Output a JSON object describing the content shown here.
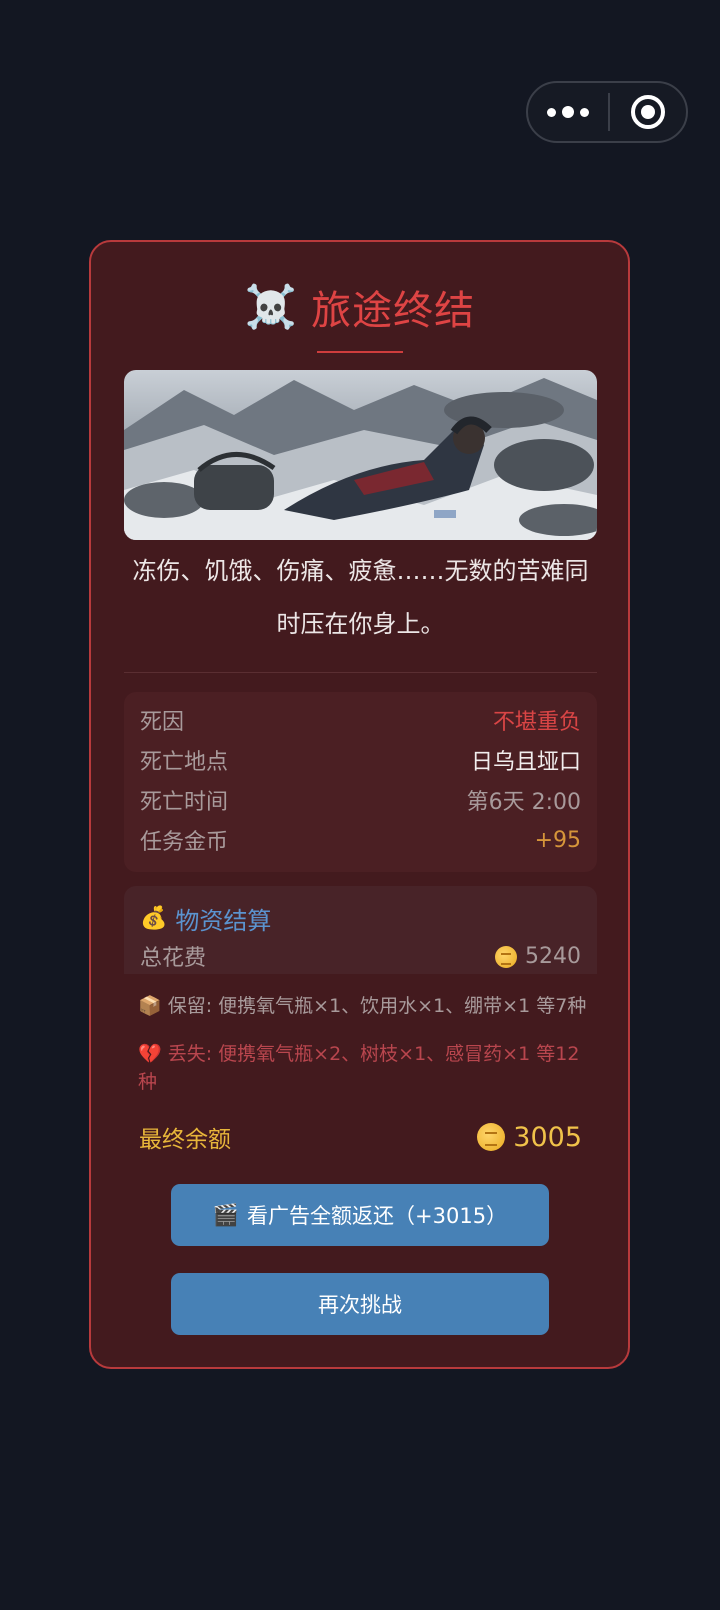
{
  "topbar": {
    "more_icon": "more-dots-icon",
    "close_icon": "target-circle-icon"
  },
  "card": {
    "icon": "☠️",
    "title": "旅途终结",
    "story": "冻伤、饥饿、伤痛、疲惫……无数的苦难同时压在你身上。",
    "death_info": [
      {
        "key": "死因",
        "value": "不堪重负",
        "color": "#d94545"
      },
      {
        "key": "死亡地点",
        "value": "日乌且垭口",
        "color": "#f2eeee"
      },
      {
        "key": "死亡时间",
        "value": "第6天 2:00",
        "color": "#a89a9b"
      },
      {
        "key": "任务金币",
        "value": "+95",
        "color": "#d6953a"
      }
    ],
    "supply": {
      "icon": "💰",
      "title": "物资结算",
      "cost_label": "总花费",
      "cost_value": "5240"
    },
    "kept_icon": "📦",
    "kept": "保留: 便携氧气瓶×1、饮用水×1、绷带×1 等7种",
    "lost_icon": "💔",
    "lost": "丢失: 便携氧气瓶×2、树枝×1、感冒药×1 等12种",
    "final_label": "最终余额",
    "final_value": "3005",
    "ad_button_icon": "🎬",
    "ad_button": "看广告全额返还（+3015）",
    "retry_button": "再次挑战"
  },
  "colors": {
    "background": "#131722",
    "card_bg": "#431a1e",
    "card_border": "#b83a3c",
    "title_red": "#de4444",
    "button_blue": "#4781b6",
    "gold": "#f0c24a",
    "supply_blue": "#5b93cf"
  }
}
